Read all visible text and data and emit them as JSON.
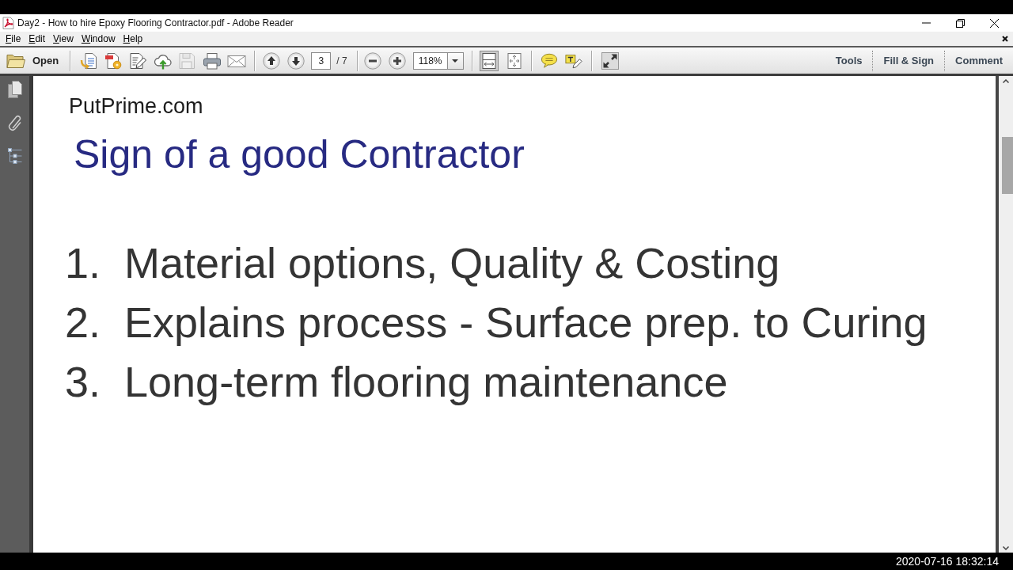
{
  "window": {
    "title": "Day2 - How to hire Epoxy Flooring Contractor.pdf - Adobe Reader"
  },
  "menu_bar": {
    "items": [
      "File",
      "Edit",
      "View",
      "Window",
      "Help"
    ]
  },
  "toolbar": {
    "open_label": "Open",
    "file_tools": [
      {
        "kind": "create",
        "disabled": false
      },
      {
        "kind": "export",
        "disabled": false
      },
      {
        "kind": "edit",
        "disabled": false
      },
      {
        "kind": "upload",
        "disabled": false
      },
      {
        "kind": "save",
        "disabled": true
      },
      {
        "kind": "print",
        "disabled": false
      },
      {
        "kind": "email",
        "disabled": false
      }
    ],
    "page_number": "3",
    "page_total": "/ 7",
    "zoom_value": "118%",
    "view_modes": [
      {
        "kind": "fit-page",
        "selected": true
      },
      {
        "kind": "fit-width",
        "selected": false
      }
    ],
    "task_buttons": [
      "Tools",
      "Fill & Sign",
      "Comment"
    ]
  },
  "document": {
    "site": "PutPrime.com",
    "heading": "Sign of a good Contractor",
    "items": [
      {
        "number": "1.",
        "text": "Material options, Quality & Costing"
      },
      {
        "number": "2.",
        "text": "Explains process - Surface prep. to Curing"
      },
      {
        "number": "3.",
        "text": "Long-term flooring maintenance"
      }
    ]
  },
  "recording_timestamp": "2020-07-16 18:32:14"
}
